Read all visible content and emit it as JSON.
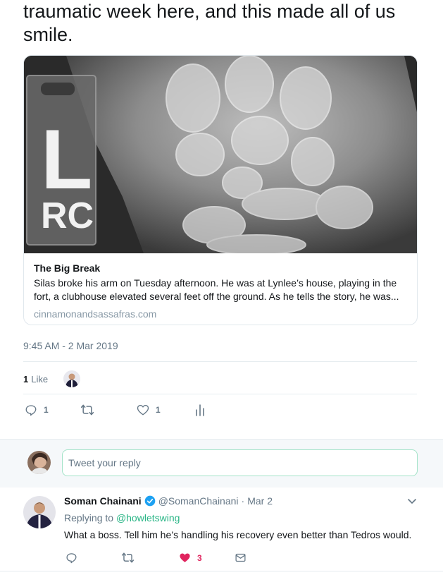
{
  "tweet": {
    "text": "traumatic week here, and this made all of us smile.",
    "timestamp": "9:45 AM - 2 Mar 2019",
    "likes": {
      "count": "1",
      "label": "Like"
    },
    "actions": {
      "reply_count": "1",
      "like_count": "1"
    }
  },
  "card": {
    "image_text": [
      "L",
      "RC"
    ],
    "title": "The Big Break",
    "description": "Silas broke his arm on Tuesday afternoon. He was at Lynlee’s house, playing in the fort, a clubhouse elevated several feet off the ground. As he tells the story, he was...",
    "domain": "cinnamonandsassafras.com"
  },
  "reply_box": {
    "placeholder": "Tweet your reply"
  },
  "reply_tweet": {
    "name": "Soman Chainani",
    "handle": "@SomanChainani",
    "separator": "·",
    "date": "Mar 2",
    "replying_prefix": "Replying to",
    "replying_to": "@howletswing",
    "text": "What a boss. Tell him he’s handling his recovery even better than Tedros would.",
    "like_count": "3"
  },
  "colors": {
    "accent_green": "#28b585",
    "like_red": "#e0245e",
    "muted": "#657786",
    "verified_blue": "#1da1f2"
  },
  "icons": [
    "reply-icon",
    "retweet-icon",
    "heart-icon",
    "analytics-icon",
    "verified-icon",
    "chevron-down-icon",
    "message-icon"
  ]
}
